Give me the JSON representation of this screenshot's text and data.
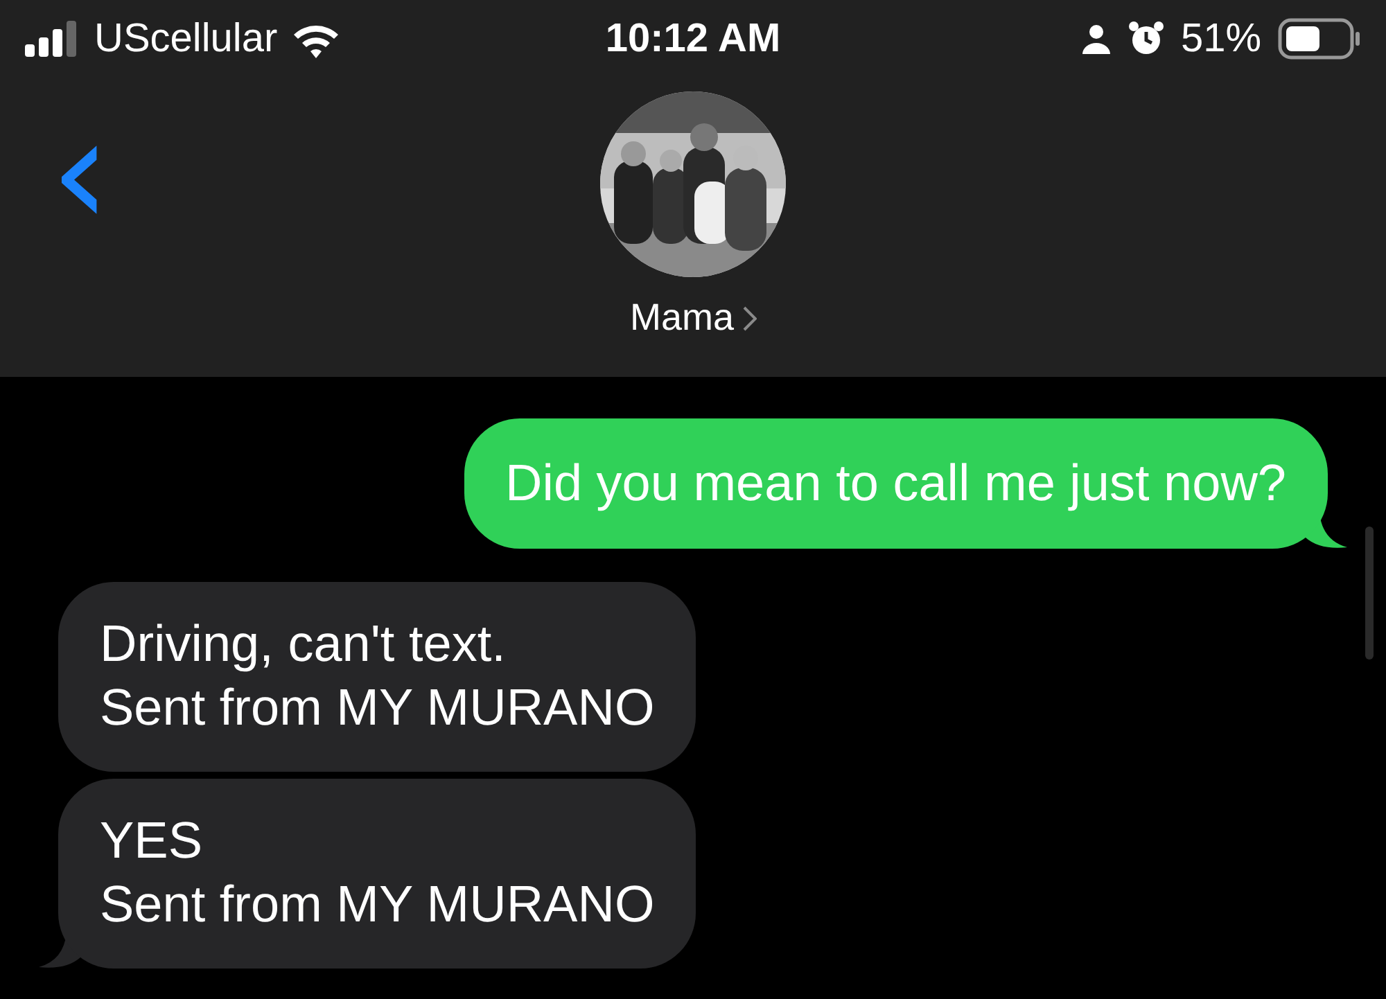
{
  "status_bar": {
    "carrier": "UScellular",
    "time": "10:12 AM",
    "battery": "51%"
  },
  "header": {
    "back": "‹",
    "contact_name": "Mama"
  },
  "messages": [
    {
      "kind": "outgoing",
      "text": "Did you mean to call me just now?",
      "tail": true
    },
    {
      "kind": "incoming",
      "text": "Driving, can't text.\nSent from MY MURANO",
      "tail": false
    },
    {
      "kind": "incoming",
      "text": "YES\nSent from MY MURANO",
      "tail": true
    }
  ]
}
